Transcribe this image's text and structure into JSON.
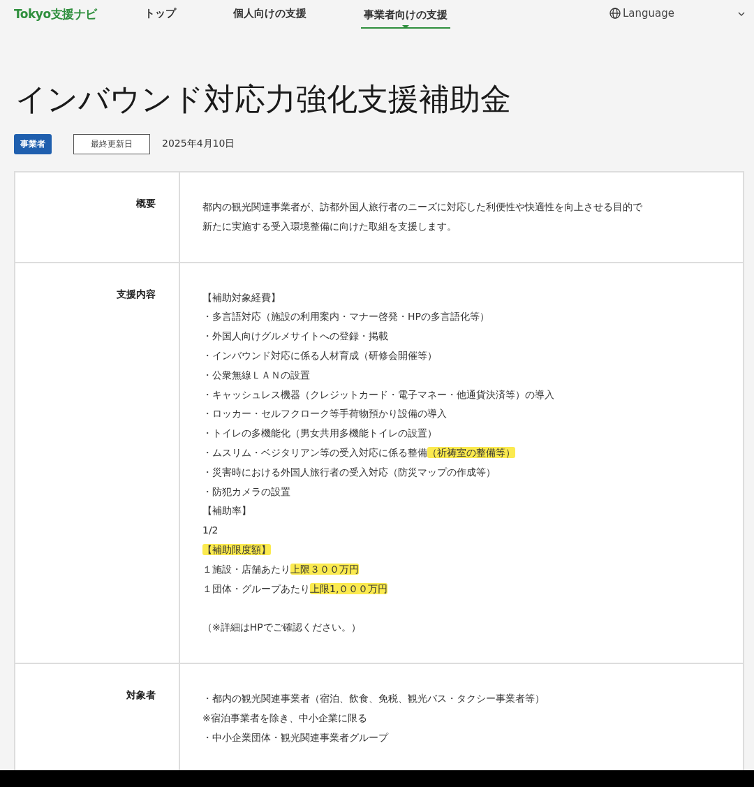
{
  "nav": {
    "logo": "Tokyo支援ナビ",
    "items": [
      {
        "label": "トップ",
        "selected": false
      },
      {
        "label": "個人向けの支援",
        "selected": false
      },
      {
        "label": "事業者向けの支援",
        "selected": true
      }
    ],
    "language": "Language"
  },
  "title": "インバウンド対応力強化支援補助金",
  "meta": {
    "tag": "事業者",
    "updated_label": "最終更新日",
    "updated_date": "2025年4月10日"
  },
  "rows": [
    {
      "label": "概要",
      "lines": [
        [
          {
            "text": "都内の観光関連事業者が、訪都外国人旅行者のニーズに対応した利便性や快適性を向上させる目的で",
            "highlight": false
          }
        ],
        [
          {
            "text": "新たに実施する受入環境整備に向けた取組を支援します。",
            "highlight": false
          }
        ]
      ]
    },
    {
      "label": "支援内容",
      "lines": [
        [
          {
            "text": "【補助対象経費】",
            "highlight": false
          }
        ],
        [
          {
            "text": "・多言語対応（施設の利用案内・マナー啓発・HPの多言語化等）",
            "highlight": false
          }
        ],
        [
          {
            "text": "・外国人向けグルメサイトへの登録・掲載",
            "highlight": false
          }
        ],
        [
          {
            "text": "・インバウンド対応に係る人材育成（研修会開催等）",
            "highlight": false
          }
        ],
        [
          {
            "text": "・公衆無線ＬＡＮの設置",
            "highlight": false
          }
        ],
        [
          {
            "text": "・キャッシュレス機器（クレジットカード・電子マネー・他通貨決済等）の導入",
            "highlight": false
          }
        ],
        [
          {
            "text": "・ロッカー・セルフクローク等手荷物預かり設備の導入",
            "highlight": false
          }
        ],
        [
          {
            "text": "・トイレの多機能化（男女共用多機能トイレの設置）",
            "highlight": false
          }
        ],
        [
          {
            "text": "・ムスリム・ベジタリアン等の受入対応に係る整備",
            "highlight": false
          },
          {
            "text": "（祈祷室の整備等）",
            "highlight": true
          }
        ],
        [
          {
            "text": "・災害時における外国人旅行者の受入対応（防災マップの作成等）",
            "highlight": false
          }
        ],
        [
          {
            "text": "・防犯カメラの設置",
            "highlight": false
          }
        ],
        [
          {
            "text": "【補助率】",
            "highlight": false
          }
        ],
        [
          {
            "text": "1/2",
            "highlight": false
          }
        ],
        [
          {
            "text": "【補助限度額】",
            "highlight": true
          }
        ],
        [
          {
            "text": "１施設・店舗あたり",
            "highlight": false
          },
          {
            "text": "上限３００万円",
            "highlight": true
          }
        ],
        [
          {
            "text": "１団体・グループあたり",
            "highlight": false
          },
          {
            "text": "上限1,０００万円",
            "highlight": true
          }
        ],
        {
          "spaced": true,
          "segments": [
            {
              "text": "（※詳細はHPでご確認ください。）",
              "highlight": false
            }
          ]
        }
      ]
    },
    {
      "label": "対象者",
      "lines": [
        [
          {
            "text": "・都内の観光関連事業者（宿泊、飲食、免税、観光バス・タクシー事業者等）",
            "highlight": false
          }
        ],
        [
          {
            "text": "※宿泊事業者を除き、中小企業に限る",
            "highlight": false
          }
        ],
        [
          {
            "text": "・中小企業団体・観光関連事業者グループ",
            "highlight": false
          }
        ]
      ]
    }
  ]
}
